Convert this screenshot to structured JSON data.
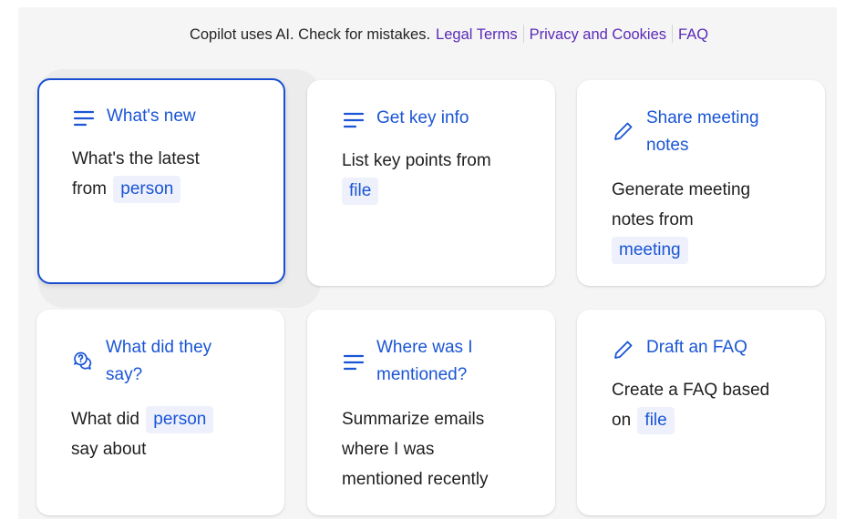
{
  "disclaimer": {
    "text": "Copilot uses AI. Check for mistakes.",
    "links": [
      "Legal Terms",
      "Privacy and Cookies",
      "FAQ"
    ]
  },
  "colors": {
    "accent": "#1a55d6",
    "focus_border": "#1a4fd1",
    "link": "#5b2ab8",
    "chip_bg": "#eef1fb"
  },
  "cards": [
    {
      "icon": "lines-icon",
      "title_line1": "What's new",
      "title_line2": "",
      "body_line1": "What's the latest",
      "body_pre": "from",
      "chip": "person",
      "body_post": ""
    },
    {
      "icon": "lines-icon",
      "title_line1": "Get key info",
      "title_line2": "",
      "body_line1": "List key points from",
      "chip": "file"
    },
    {
      "icon": "pencil-icon",
      "title_line1": "Share meeting",
      "title_line2": "notes",
      "body_line1": "Generate meeting",
      "body_line2": "notes from",
      "chip": "meeting"
    },
    {
      "icon": "chat-question-icon",
      "title_line1": "What did they",
      "title_line2": "say?",
      "body_pre": "What did",
      "chip": "person",
      "body_line2": "say about"
    },
    {
      "icon": "lines-icon",
      "title_line1": "Where was I",
      "title_line2": "mentioned?",
      "body_line1": "Summarize emails",
      "body_line2": "where I was",
      "body_line3": "mentioned recently"
    },
    {
      "icon": "pencil-icon",
      "title_line1": "Draft an FAQ",
      "title_line2": "",
      "body_line1": "Create a FAQ based",
      "body_pre": "on",
      "chip": "file"
    }
  ]
}
